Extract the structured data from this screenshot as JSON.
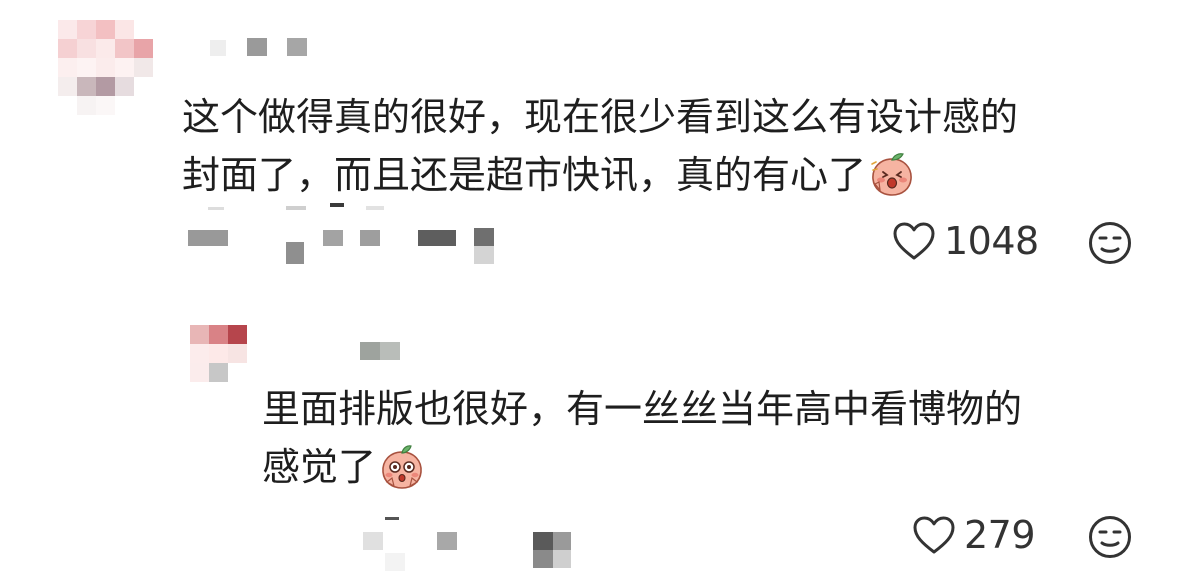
{
  "comments": [
    {
      "text_lines": [
        "这个做得真的很好，现在很少看到这么有设计感的",
        "封面了，而且还是超市快讯，真的有心了"
      ],
      "emoji": "peach-surprised-emoji",
      "like_count": "1048",
      "like_icon": "heart-outline-icon",
      "reaction_icon": "neutral-face-icon",
      "reply": {
        "text_lines": [
          "里面排版也很好，有一丝丝当年高中看博物的",
          "感觉了"
        ],
        "emoji": "peach-wow-emoji",
        "like_count": "279",
        "like_icon": "heart-outline-icon",
        "reaction_icon": "neutral-face-icon"
      }
    }
  ],
  "colors": {
    "text": "#1e1e1e",
    "icon": "#333333",
    "peach": "#f2a48e",
    "peach_cheek": "#e8746a",
    "leaf": "#6bb36b"
  }
}
